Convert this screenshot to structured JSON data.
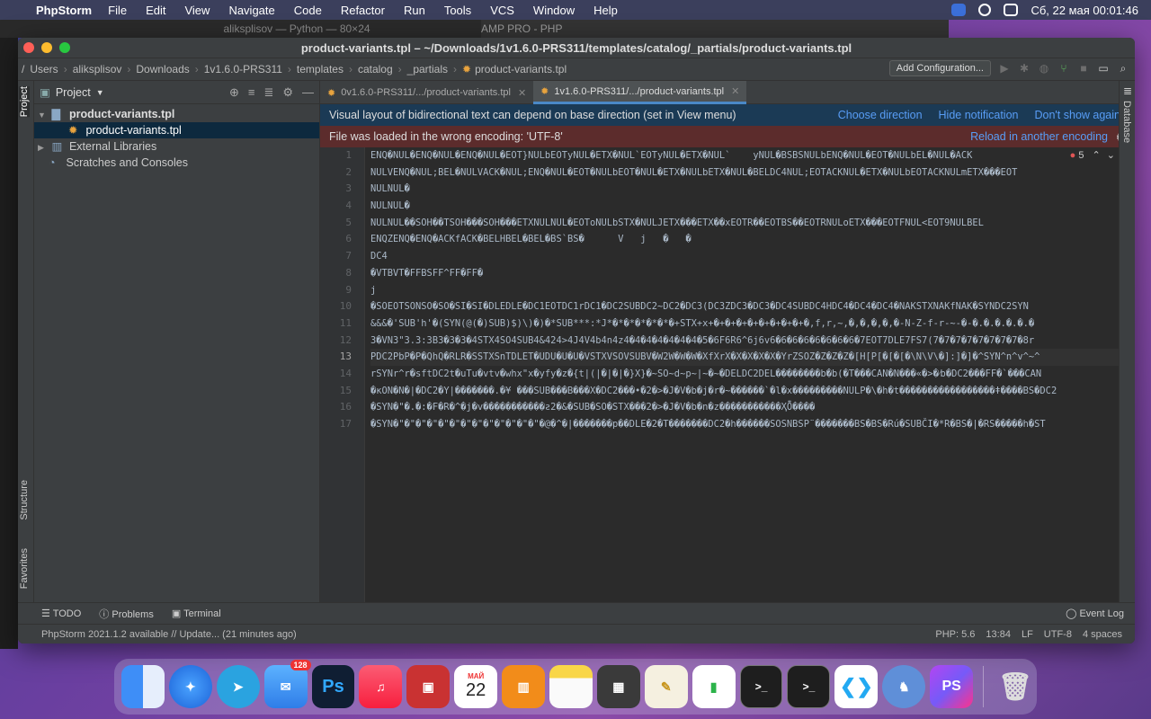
{
  "menubar": {
    "app_name": "PhpStorm",
    "items": [
      "File",
      "Edit",
      "View",
      "Navigate",
      "Code",
      "Refactor",
      "Run",
      "Tools",
      "VCS",
      "Window",
      "Help"
    ],
    "clock": "Сб, 22 мая  00:01:46"
  },
  "background": {
    "terminal_title": "aliksplisov — Python — 80×24",
    "other_title": "AMP PRO - PHP"
  },
  "window": {
    "title": "product-variants.tpl – ~/Downloads/1v1.6.0-PRS311/templates/catalog/_partials/product-variants.tpl"
  },
  "breadcrumbs": [
    "/",
    "Users",
    "aliksplisov",
    "Downloads",
    "1v1.6.0-PRS311",
    "templates",
    "catalog",
    "_partials",
    "product-variants.tpl"
  ],
  "toolbar": {
    "add_config_label": "Add Configuration..."
  },
  "left_tabs": {
    "project": "Project",
    "structure": "Structure",
    "favorites": "Favorites"
  },
  "project_panel": {
    "header": "Project",
    "tree": [
      {
        "label": "product-variants.tpl",
        "level": 0,
        "expanded": true,
        "bold": true
      },
      {
        "label": "product-variants.tpl",
        "level": 1,
        "selected": true
      },
      {
        "label": "External Libraries",
        "level": 0,
        "expanded": false
      },
      {
        "label": "Scratches and Consoles",
        "level": 0
      }
    ]
  },
  "editor_tabs": [
    {
      "label": "0v1.6.0-PRS311/.../product-variants.tpl",
      "active": false
    },
    {
      "label": "1v1.6.0-PRS311/.../product-variants.tpl",
      "active": true
    }
  ],
  "notification": {
    "text": "Visual layout of bidirectional text can depend on base direction (set in View menu)",
    "links": [
      "Choose direction",
      "Hide notification",
      "Don't show again"
    ]
  },
  "encoding_banner": {
    "text": "File was loaded in the wrong encoding: 'UTF-8'",
    "link": "Reload in another encoding"
  },
  "error_count": "5",
  "code_lines": [
    "ENQ�NUL�ENQ�NUL�ENQ�NUL�EOT}NULbEOTyNUL�ETX�NUL`EOTyNUL�ETX�NUL`    yNUL�BSBSNULbENQ�NUL�EOT�NULbEL�NUL�ACK",
    "NULVENQ�NUL;BEL�NULVACK�NUL;ENQ�NUL�EOT�NULbEOT�NUL�ETX�NULbETX�NUL�BELDC4NUL;EOTACKNUL�ETX�NULbEOTACKNULmETX���EOT",
    "NULNUL�",
    "NULNUL�",
    "NULNUL��SOH��TSOH���SOH���ETXNULNUL�EOToNULbSTX�NULJETX���ETX��xEOTR��EOTBS��EOTRNULoETX���EOTFNUL<EOT9NULBEL",
    "ENQZENQ�ENQ�ACKfACK�BELHBEL�BEL�BS`BS�      V   j   �   �",
    "DC4",
    "�VTBVT�FFBSFF^FF�FF�",
    "j",
    "�SOEOTSONSO�SO�SI�SI�DLEDLE�DC1EOTDC1rDC1�DC2SUBDC2~DC2�DC3(DC3ZDC3�DC3�DC4SUBDC4HDC4�DC4�DC4�NAKSTXNAKfNAK�SYNDC2SYN",
    "&&&�'SUB'h'�(SYN(@(�)SUB)$)\\)�)�*SUB***:*J*�*�*�*�*�*�+STX+x+�+�+�+�+�+�+�+�+�,f,r,~,�,�,�,�,�-N-Z-f-r-~-�-�.�.�.�.�.�",
    "3�VN3\"3.3:3B3�3�3�4STX4SO4SUB4&424>4J4V4b4n4z4�4�4�4�4�4�4�5�6F6R6^6j6v6�6�6�6�6�6�6�6�7EOT7DLE7FS7(7�7�7�7�7�7�7�7�8r",
    "PDC2PbP�P�QhQ�RLR�SSTXSnTDLET�UDU�U�U�VSTXVSOVSUBV�W2W�W�W�XfXrX�X�X�X�X�YrZSOZ�Z�Z�Z�[H[P[�[�[�\\N\\V\\�]:]�]�^SYN^n^v^~^",
    "rSYNr^r�sftDC2t�uTu�vtv�whx\"x�yfy�z�{t|(|�|�|�}X}�~SO~d~p~|~�~�DELDC2DEL��������b�b(�T���CAN�N���«�>�⁄b�DC2���FF�`���CAN",
    "�кON�N�|�DC2�Y|�������.�¥ ���SUB���B���X�DC2���•�2�>�J�V�b�j�r�~������`�l�x���������NULP�\\�h�t�����������������ǂ����BS�DC2",
    "�SYN�\"�.�:�F�R�^�j�v�����������ƨ2�&�SUB�SO�STX���2�>�J�V�b�n�z�����������ҲȬ����",
    "�SYN�\"�\"�\"�\"�\"�\"�\"�\"�\"�\"�\"�\"�\"�@�^�|�������p��DLE�2�T�������DC2�h������SOSNBSP¨�������BS�BS�Rú�SUBČI�*R�BS�|�RS�����h�ST"
  ],
  "cursor_line": 13,
  "bottom_tools": [
    "TODO",
    "Problems",
    "Terminal"
  ],
  "event_log": "Event Log",
  "right_tab": "Database",
  "status": {
    "message": "PhpStorm 2021.1.2 available // Update... (21 minutes ago)",
    "php": "PHP: 5.6",
    "position": "13:84",
    "line_sep": "LF",
    "encoding": "UTF-8",
    "indent": "4 spaces"
  },
  "dock": {
    "calendar_month": "МАЙ",
    "calendar_day": "22",
    "mail_badge": "128"
  }
}
